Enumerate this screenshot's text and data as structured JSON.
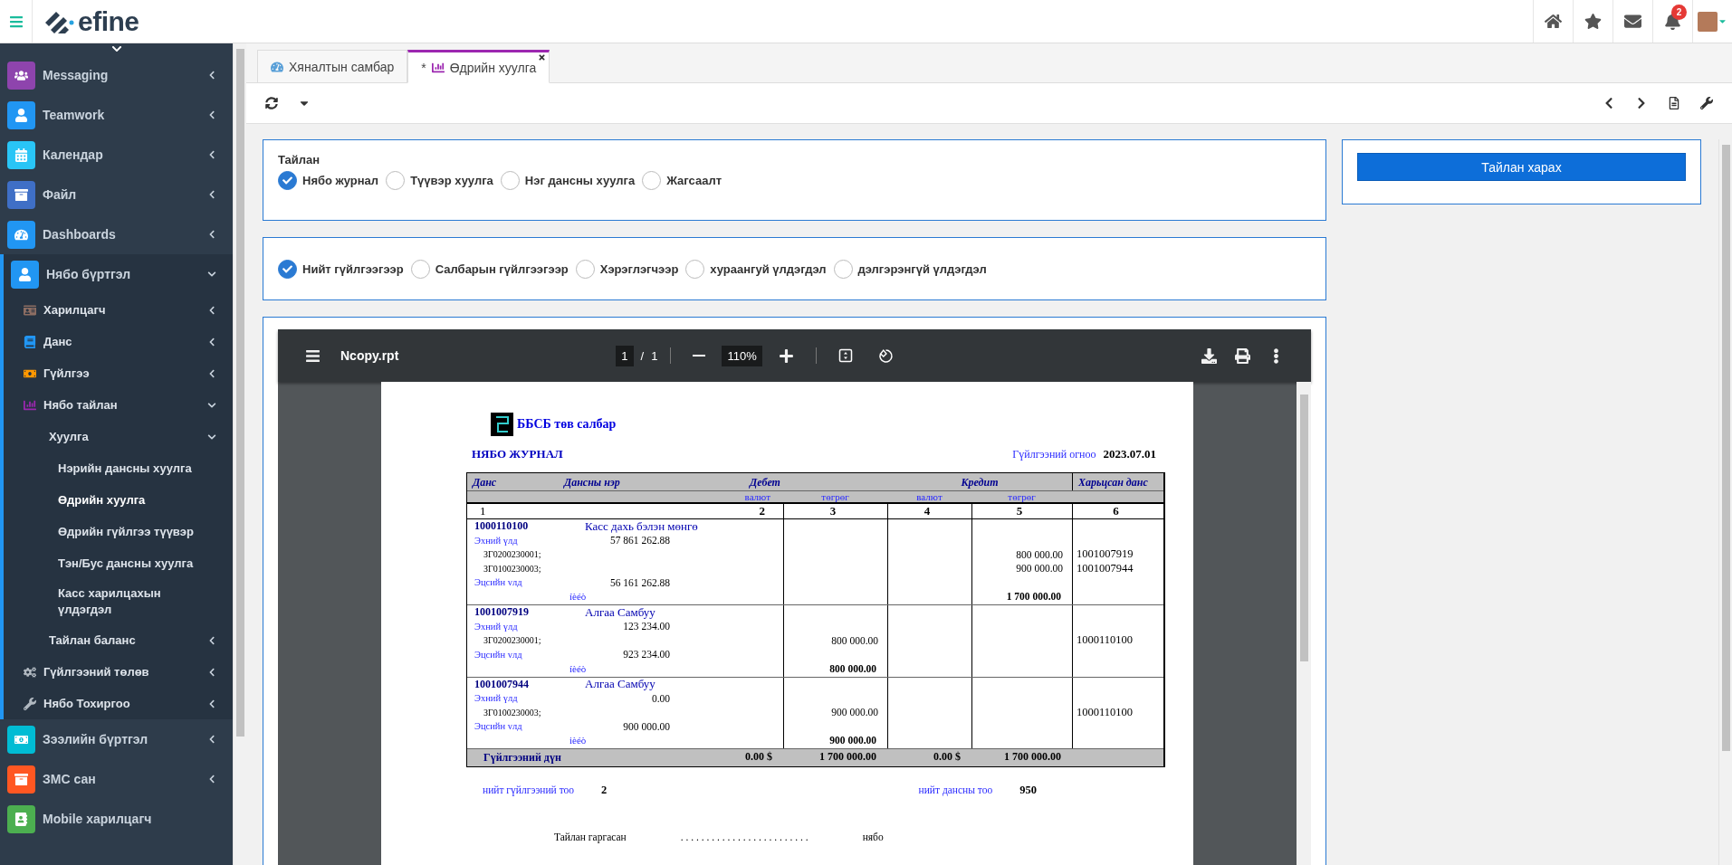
{
  "topbar": {
    "brand": "efine",
    "notifications": "2"
  },
  "sidebar": {
    "items": [
      {
        "label": "Messaging",
        "color": "#8e44ad",
        "expanded": false
      },
      {
        "label": "Teamwork",
        "color": "#2196f3",
        "expanded": false
      },
      {
        "label": "Календар",
        "color": "#29c5f6",
        "expanded": false
      },
      {
        "label": "Файл",
        "color": "#3f6fc6",
        "expanded": false
      },
      {
        "label": "Dashboards",
        "color": "#2196f3",
        "expanded": false
      },
      {
        "label": "Нябо бүртгэл",
        "color": "#2196f3",
        "expanded": true,
        "children": [
          {
            "label": "Харилцагч",
            "color": "#8d6e63",
            "expanded": false
          },
          {
            "label": "Данс",
            "color": "#2196f3",
            "expanded": false
          },
          {
            "label": "Гүйлгээ",
            "color": "#ff9800",
            "expanded": false
          },
          {
            "label": "Нябо тайлан",
            "color": "#9c27b0",
            "expanded": true,
            "children": [
              {
                "label": "Хуулга",
                "expanded": true,
                "children": [
                  {
                    "label": "Нэрийн дансны хуулга",
                    "selected": false
                  },
                  {
                    "label": "Өдрийн хуулга",
                    "selected": true
                  },
                  {
                    "label": "Өдрийн гүйлгээ түүвэр",
                    "selected": false
                  },
                  {
                    "label": "Тэн/Бус дансны хуулга",
                    "selected": false
                  },
                  {
                    "label": "Касс харилцахын үлдэгдэл",
                    "selected": false
                  }
                ]
              },
              {
                "label": "Тайлан баланс",
                "expanded": false
              }
            ]
          },
          {
            "label": "Гүйлгээний төлөв",
            "color": "#b0b8c0",
            "expanded": false
          },
          {
            "label": "Нябо Тохиргоо",
            "color": "#b0b8c0",
            "expanded": false
          }
        ]
      },
      {
        "label": "Зээлийн бүртгэл",
        "color": "#00bcd4",
        "expanded": false
      },
      {
        "label": "ЗМС сан",
        "color": "#ff5722",
        "expanded": false
      },
      {
        "label": "Mobile харилцагч",
        "color": "#4caf50"
      }
    ]
  },
  "tabs": [
    {
      "label": "Хяналтын самбар",
      "selected": false
    },
    {
      "label": "Өдрийн хуулга",
      "selected": true,
      "modified_mark": "*"
    }
  ],
  "report_type": {
    "label": "Тайлан",
    "options": [
      {
        "label": "Нябо журнал",
        "selected": true
      },
      {
        "label": "Түүвэр хуулга",
        "selected": false
      },
      {
        "label": "Нэг дансны хуулга",
        "selected": false
      },
      {
        "label": "Жагсаалт",
        "selected": false
      }
    ]
  },
  "grouping": {
    "options": [
      {
        "label": "Нийт гүйлгээгээр",
        "selected": true
      },
      {
        "label": "Салбарын гүйлгээгээр",
        "selected": false
      },
      {
        "label": "Хэрэглэгчээр",
        "selected": false
      },
      {
        "label": "хураангуй үлдэгдэл",
        "selected": false
      },
      {
        "label": "дэлгэрэнгүй үлдэгдэл",
        "selected": false
      }
    ]
  },
  "view_button": "Тайлан харах",
  "viewer": {
    "filename": "Ncopy.rpt",
    "page": "1",
    "page_separator": "/",
    "page_count": "1",
    "zoom": "110%"
  },
  "report": {
    "company": "ББСБ төв салбар",
    "title": "НЯБО ЖУРНАЛ",
    "date_label": "Гүйлгээний огноо",
    "date": "2023.07.01",
    "header": {
      "account": "Данс",
      "account_name": "Дансны нэр",
      "debit": "Дебет",
      "credit": "Кредит",
      "contra": "Харьцсан данс",
      "sub": [
        "валют",
        "төгрөг",
        "валют",
        "төгрөг"
      ],
      "numbers": [
        "1",
        "2",
        "3",
        "4",
        "5",
        "6"
      ]
    },
    "groups": [
      {
        "account": "1000110100",
        "name": "Касс дахь бэлэн мөнгө",
        "opening_label": "Эхний үлд",
        "opening": "57 861 262.88",
        "lines": [
          {
            "ref": "ЗГ0200230001;",
            "credit": "800 000.00",
            "contra": "1001007919"
          },
          {
            "ref": "ЗГ0100230003;",
            "credit": "900 000.00",
            "contra": "1001007944"
          }
        ],
        "closing_label": "Эцсийн vлд",
        "closing": "56 161 262.88",
        "total_label": "íèéò",
        "credit_total": "1 700 000.00"
      },
      {
        "account": "1001007919",
        "name": "Алгаа  Самбуу",
        "opening_label": "Эхний үлд",
        "opening": "123 234.00",
        "lines": [
          {
            "ref": "ЗГ0200230001;",
            "debit": "800 000.00",
            "contra": "1000110100"
          }
        ],
        "closing_label": "Эцсийн vлд",
        "closing": "923 234.00",
        "total_label": "íèéò",
        "debit_total": "800 000.00"
      },
      {
        "account": "1001007944",
        "name": "Алгаа  Самбуу",
        "opening_label": "Эхний үлд",
        "opening": "0.00",
        "lines": [
          {
            "ref": "ЗГ0100230003;",
            "debit": "900 000.00",
            "contra": "1000110100"
          }
        ],
        "closing_label": "Эцсийн vлд",
        "closing": "900 000.00",
        "total_label": "ièéò",
        "debit_total": "900 000.00"
      }
    ],
    "totals": {
      "label": "Гүйлгээний дүн",
      "debit_fx": "0.00  $",
      "debit": "1 700 000.00",
      "credit_fx": "0.00  $",
      "credit": "1 700 000.00"
    },
    "summary": [
      {
        "label": "нийт гүйлгээний тоо",
        "value": "2"
      },
      {
        "label": "нийт дансны тоо",
        "value": "950"
      }
    ],
    "signature": {
      "label": "Тайлан гаргасан",
      "dots": ". . . . . . . . . . . . . . . . . . . . . . . . .",
      "role": "нябо"
    }
  }
}
